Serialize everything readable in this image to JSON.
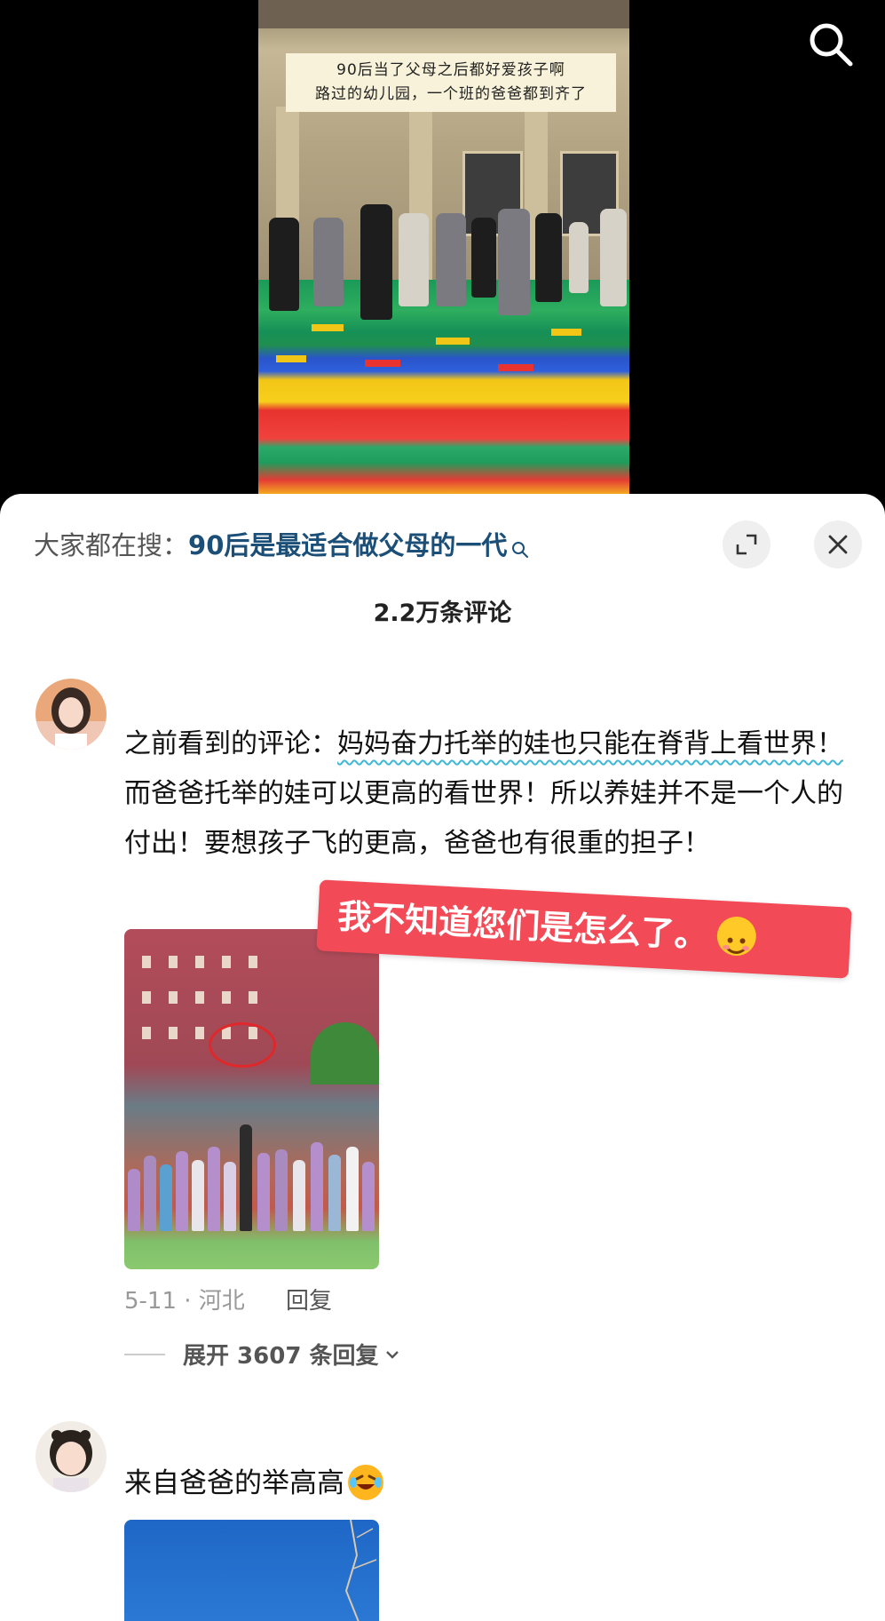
{
  "video": {
    "caption_line1": "90后当了父母之后都好爱孩子啊",
    "caption_line2": "路过的幼儿园，一个班的爸爸都到齐了"
  },
  "icons": {
    "search": "search-icon",
    "expand": "expand-icon",
    "close": "close-icon",
    "chevron": "chevron-down-icon"
  },
  "hot_search": {
    "label": "大家都在搜：",
    "term": "90后是最适合做父母的一代"
  },
  "comments_header": {
    "count_label": "2.2万条评论"
  },
  "comments": [
    {
      "text_before": "之前看到的评论：",
      "text_underlined": "妈妈奋力托举的娃也只能在脊背上看世界！",
      "text_after": "而爸爸托举的娃可以更高的看世界！所以养娃并不是一个人的付出！要想孩子飞的更高，爸爸也有很重的担子！",
      "sticker": "我不知道您们是怎么了。",
      "date_location": "5-11 · 河北",
      "reply_label": "回复",
      "expand_label": "展开 3607 条回复"
    },
    {
      "text": "来自爸爸的举高高"
    }
  ],
  "colors": {
    "hot_term": "#1b4f78",
    "underline": "#3fb8d6",
    "sticker_bg": "#f24a57"
  }
}
